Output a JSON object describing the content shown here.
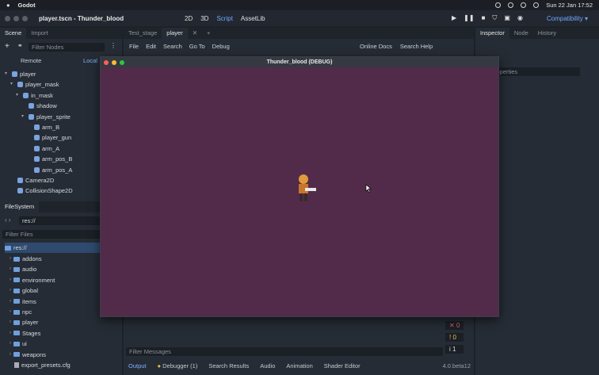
{
  "macbar": {
    "apple": "",
    "app": "Godot",
    "clock": "Sun 22 Jan 17:52"
  },
  "titlebar": {
    "title": "player.tscn - Thunder_blood",
    "modes": [
      "2D",
      "3D",
      "Script",
      "AssetLib"
    ],
    "play_icons": [
      "▶",
      "❚❚",
      "■",
      "⛉",
      "▣",
      "◉"
    ],
    "compat": "Compatibility ▾"
  },
  "scene_dock": {
    "tabs": [
      "Scene",
      "Import"
    ],
    "filter_placeholder": "Filter Nodes",
    "remote": "Remote",
    "local": "Local",
    "nodes": [
      {
        "label": "player",
        "depth": 0,
        "arrow": "▾"
      },
      {
        "label": "player_mask",
        "depth": 1,
        "arrow": "▾"
      },
      {
        "label": "in_mask",
        "depth": 2,
        "arrow": "▾"
      },
      {
        "label": "shadow",
        "depth": 3,
        "arrow": ""
      },
      {
        "label": "player_sprite",
        "depth": 3,
        "arrow": "▾"
      },
      {
        "label": "arm_B",
        "depth": 4,
        "arrow": ""
      },
      {
        "label": "player_gun",
        "depth": 4,
        "arrow": ""
      },
      {
        "label": "arm_A",
        "depth": 4,
        "arrow": ""
      },
      {
        "label": "arm_pos_B",
        "depth": 4,
        "arrow": ""
      },
      {
        "label": "arm_pos_A",
        "depth": 4,
        "arrow": ""
      },
      {
        "label": "Camera2D",
        "depth": 1,
        "arrow": ""
      },
      {
        "label": "CollisionShape2D",
        "depth": 1,
        "arrow": ""
      }
    ]
  },
  "filesystem": {
    "title": "FileSystem",
    "path": "res://",
    "filter_placeholder": "Filter Files",
    "root": "res://",
    "folders": [
      "addons",
      "audio",
      "environment",
      "global",
      "items",
      "npc",
      "player",
      "Stages",
      "ui",
      "weapons"
    ],
    "file": "export_presets.cfg"
  },
  "editor_tabs": [
    "Test_stage",
    "player"
  ],
  "menu": [
    "File",
    "Edit",
    "Search",
    "Go To",
    "Debug"
  ],
  "help": {
    "docs": "Online Docs",
    "search": "Search Help"
  },
  "inspector": {
    "tabs": [
      "Inspector",
      "Node",
      "History"
    ],
    "properties": "roperties"
  },
  "game_window": {
    "title": "Thunder_blood (DEBUG)"
  },
  "output": {
    "filter_placeholder": "Filter Messages",
    "counts": [
      "0",
      "0",
      "1"
    ]
  },
  "bottom_tabs": [
    "Output",
    "Debugger (1)",
    "Search Results",
    "Audio",
    "Animation",
    "Shader Editor"
  ],
  "version": "4.0.beta12"
}
